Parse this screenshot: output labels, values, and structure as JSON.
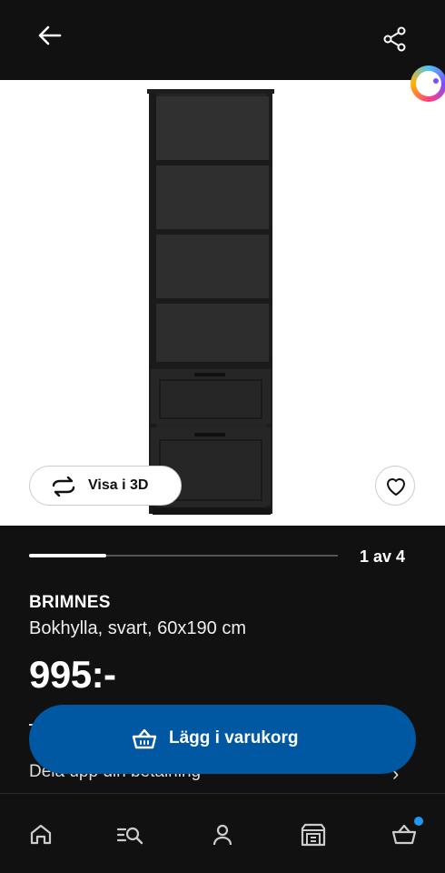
{
  "header": {
    "back_icon": "arrow-left-icon",
    "share_icon": "share-icon"
  },
  "gallery": {
    "view_3d_label": "Visa i 3D",
    "view_3d_icon": "rotate-3d-icon",
    "favorite_icon": "heart-icon",
    "assistant_icon": "assistant-orb-icon",
    "position": 1,
    "total": 4,
    "counter_text": "1 av 4",
    "progress_fraction": 0.25
  },
  "product": {
    "name": "BRIMNES",
    "description": "Bokhylla, svart, 60x190 cm",
    "price": "995:-"
  },
  "partially_hidden": {
    "installment_text": "Dela upp din betalning"
  },
  "cta": {
    "label": "Lägg i varukorg",
    "icon": "basket-icon",
    "color": "#0058a3"
  },
  "bottom_nav": {
    "items": [
      {
        "icon": "home-icon"
      },
      {
        "icon": "search-products-icon"
      },
      {
        "icon": "profile-icon"
      },
      {
        "icon": "store-icon"
      },
      {
        "icon": "basket-icon",
        "badge": true
      }
    ]
  }
}
